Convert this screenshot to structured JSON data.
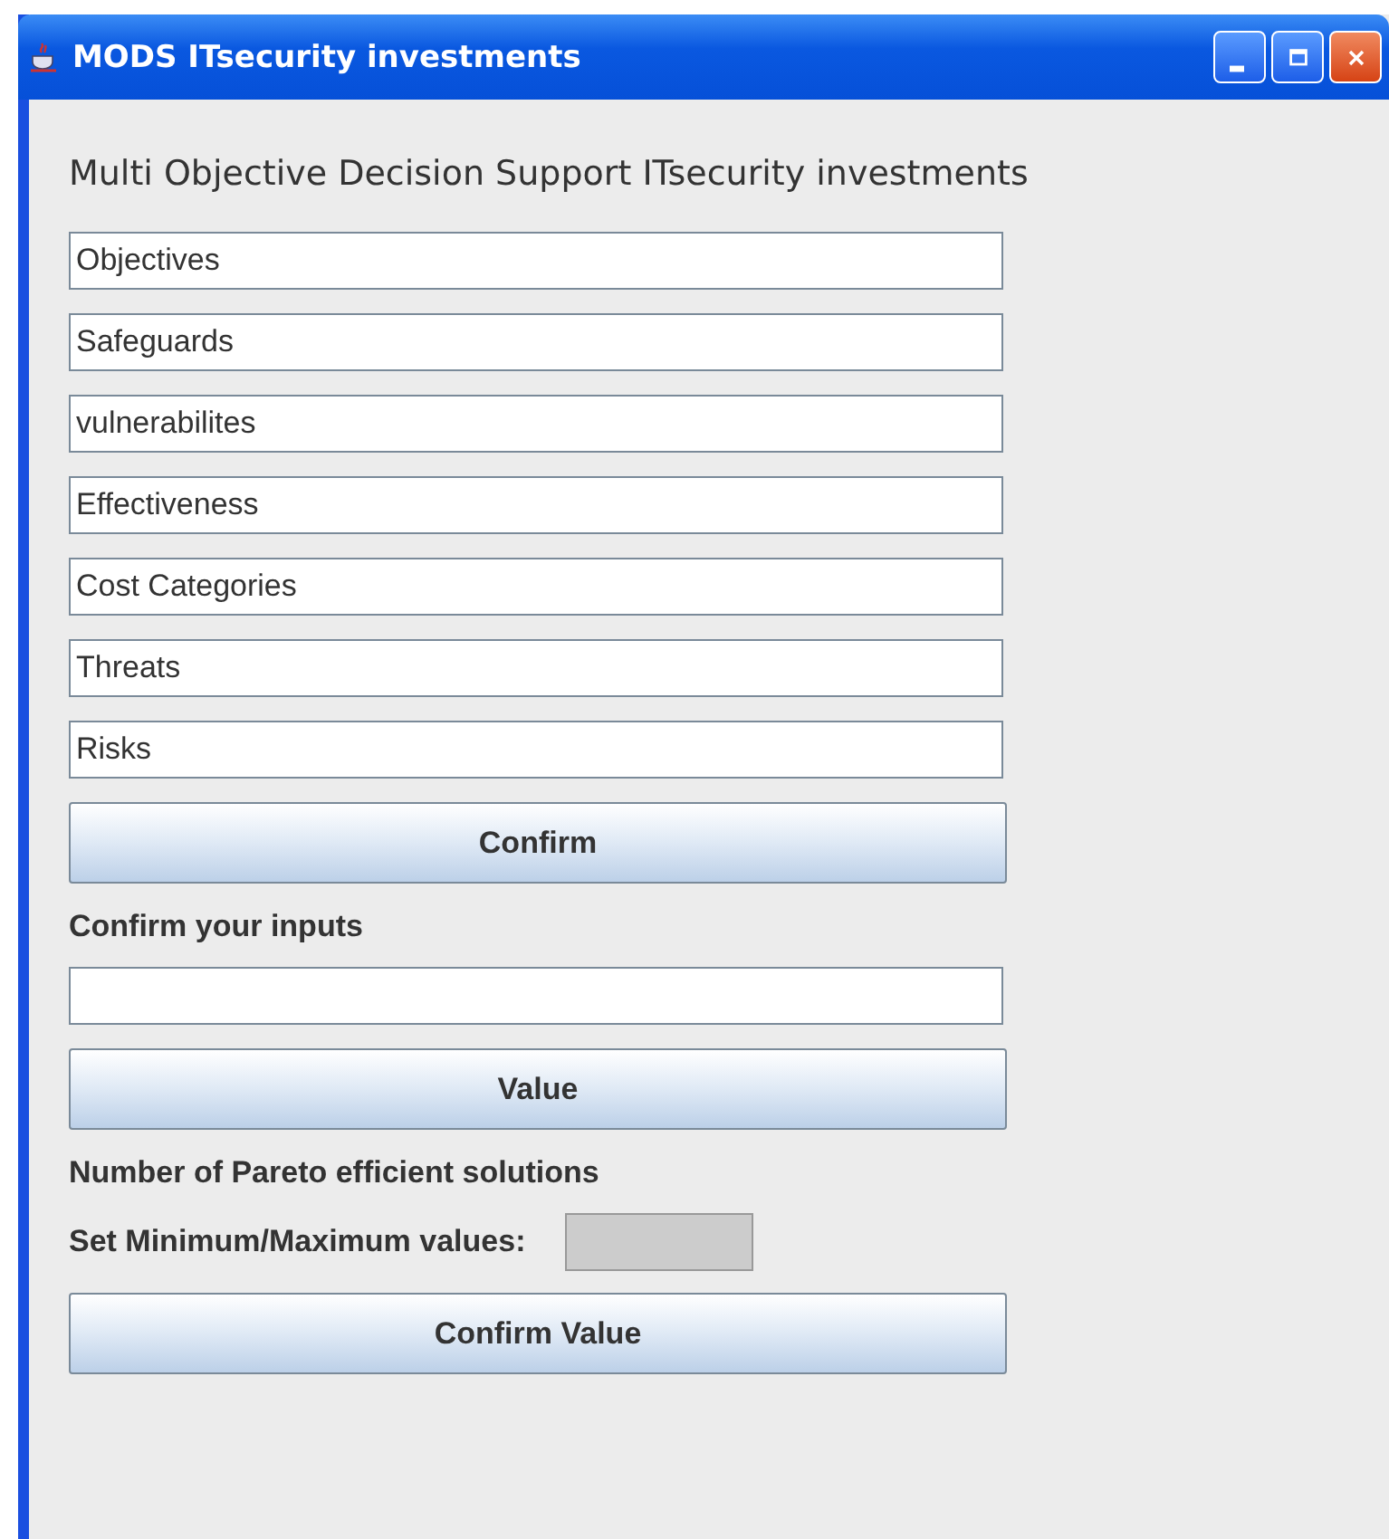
{
  "window": {
    "title": "MODS ITsecurity investments"
  },
  "heading": "Multi Objective Decision Support ITsecurity investments",
  "fields": [
    {
      "value": "Objectives"
    },
    {
      "value": "Safeguards"
    },
    {
      "value": "vulnerabilites"
    },
    {
      "value": "Effectiveness"
    },
    {
      "value": "Cost Categories"
    },
    {
      "value": "Threats"
    },
    {
      "value": "Risks"
    }
  ],
  "confirm_button": "Confirm",
  "confirm_label": "Confirm your inputs",
  "confirm_field": {
    "disabled": false
  },
  "value_button": "Value",
  "pareto_label": "Number of Pareto efficient solutions",
  "minmax_label": "Set Minimum/Maximum values:",
  "minmax_field": {
    "disabled": true
  },
  "confirm_value_button": "Confirm Value"
}
